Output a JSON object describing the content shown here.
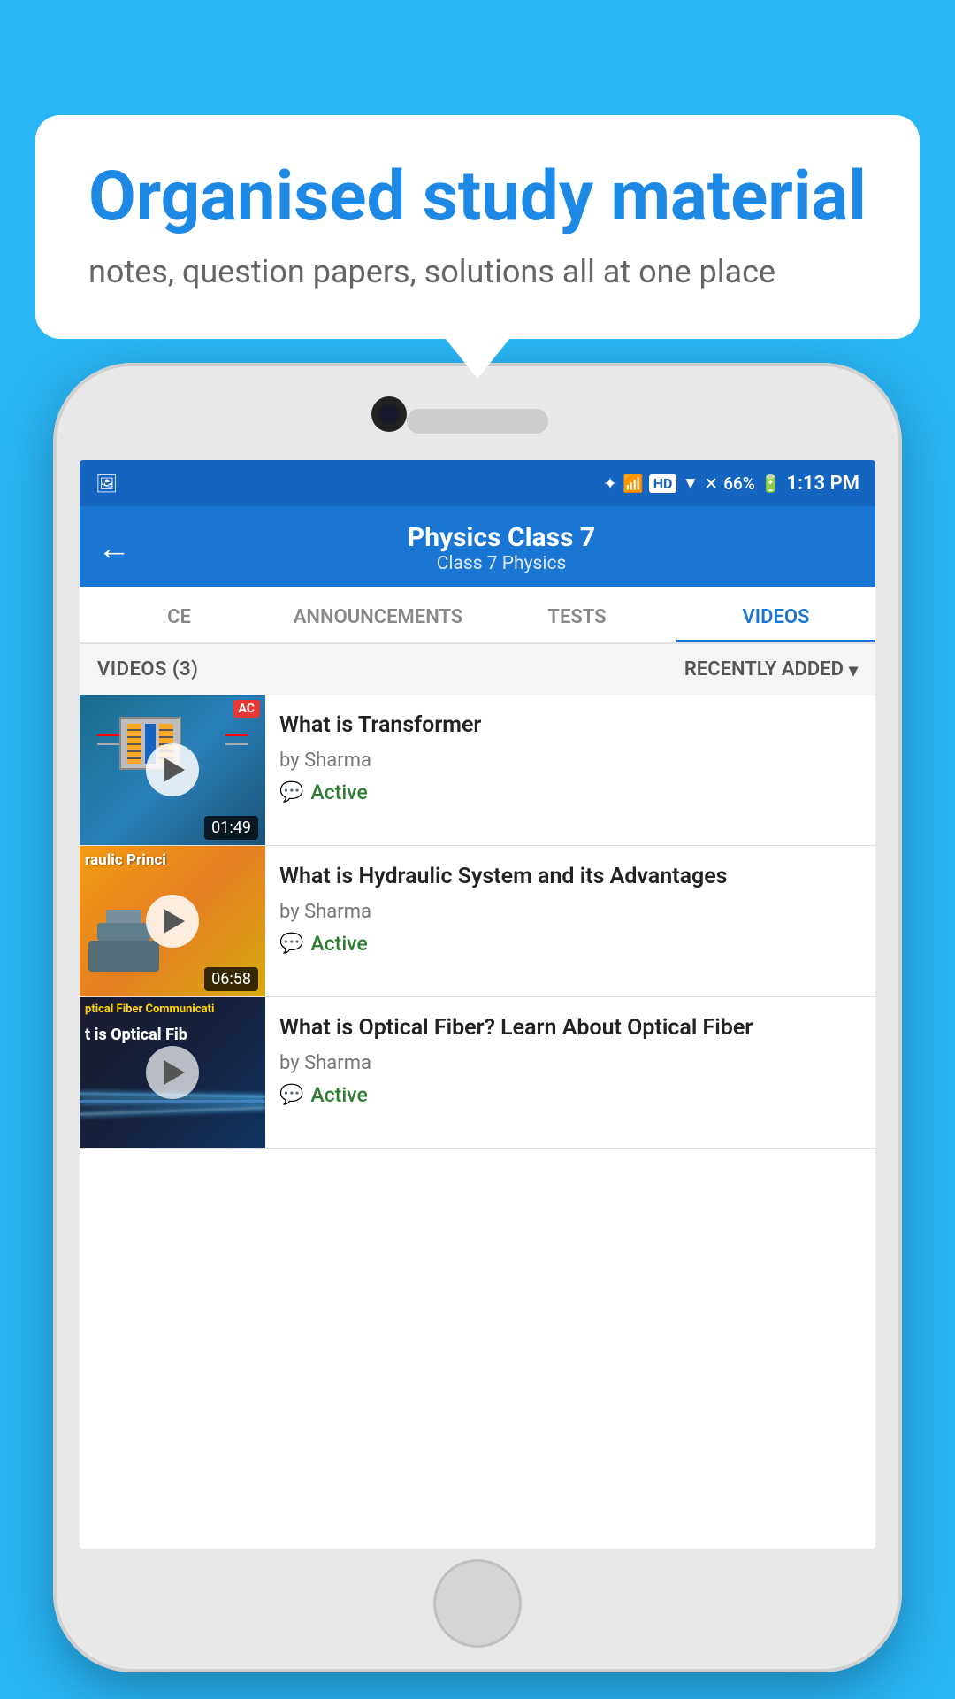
{
  "bubble": {
    "title": "Organised study material",
    "subtitle": "notes, question papers, solutions all at one place"
  },
  "statusBar": {
    "time": "1:13 PM",
    "battery": "66%",
    "signal": "HD"
  },
  "appHeader": {
    "backLabel": "←",
    "title": "Physics Class 7",
    "breadcrumb": "Class 7   Physics"
  },
  "tabs": [
    {
      "label": "CE",
      "active": false
    },
    {
      "label": "ANNOUNCEMENTS",
      "active": false
    },
    {
      "label": "TESTS",
      "active": false
    },
    {
      "label": "VIDEOS",
      "active": true
    }
  ],
  "listHeader": {
    "count": "VIDEOS (3)",
    "sort": "RECENTLY ADDED"
  },
  "videos": [
    {
      "title": "What is  Transformer",
      "author": "by Sharma",
      "status": "Active",
      "duration": "01:49",
      "thumbStyle": "1",
      "thumbOverlayText": ""
    },
    {
      "title": "What is Hydraulic System and its Advantages",
      "author": "by Sharma",
      "status": "Active",
      "duration": "06:58",
      "thumbStyle": "2",
      "thumbOverlayText": "Hydraulic Princi"
    },
    {
      "title": "What is Optical Fiber? Learn About Optical Fiber",
      "author": "by Sharma",
      "status": "Active",
      "duration": "",
      "thumbStyle": "3",
      "thumbOverlayText": "Optical Fiber Communicati"
    }
  ]
}
